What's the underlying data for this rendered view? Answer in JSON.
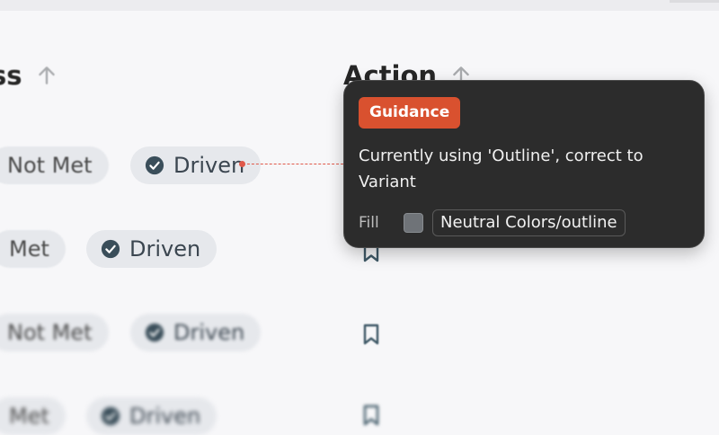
{
  "table": {
    "columns": {
      "progress": {
        "label": "ss"
      },
      "action": {
        "label": "Action"
      }
    },
    "rows": [
      {
        "status": "Not Met",
        "driver": "Driven"
      },
      {
        "status": "Met",
        "driver": "Driven"
      },
      {
        "status": "Not Met",
        "driver": "Driven"
      },
      {
        "status": "Met",
        "driver": "Driven"
      }
    ]
  },
  "tooltip": {
    "badge": "Guidance",
    "message": "Currently using 'Outline', correct to Variant",
    "property_label": "Fill",
    "token": "Neutral Colors/outline"
  },
  "colors": {
    "badge": "#d9512f",
    "connector": "#e0594a",
    "tooltip_bg": "#2c2c2c",
    "chip_bg": "#e6e8ec",
    "check": "#3a4e5a"
  },
  "icons": {
    "sort": "arrow-up-icon",
    "driven": "check-circle-icon",
    "action": "bookmark-icon",
    "fill_swatch": "color-swatch-icon"
  }
}
